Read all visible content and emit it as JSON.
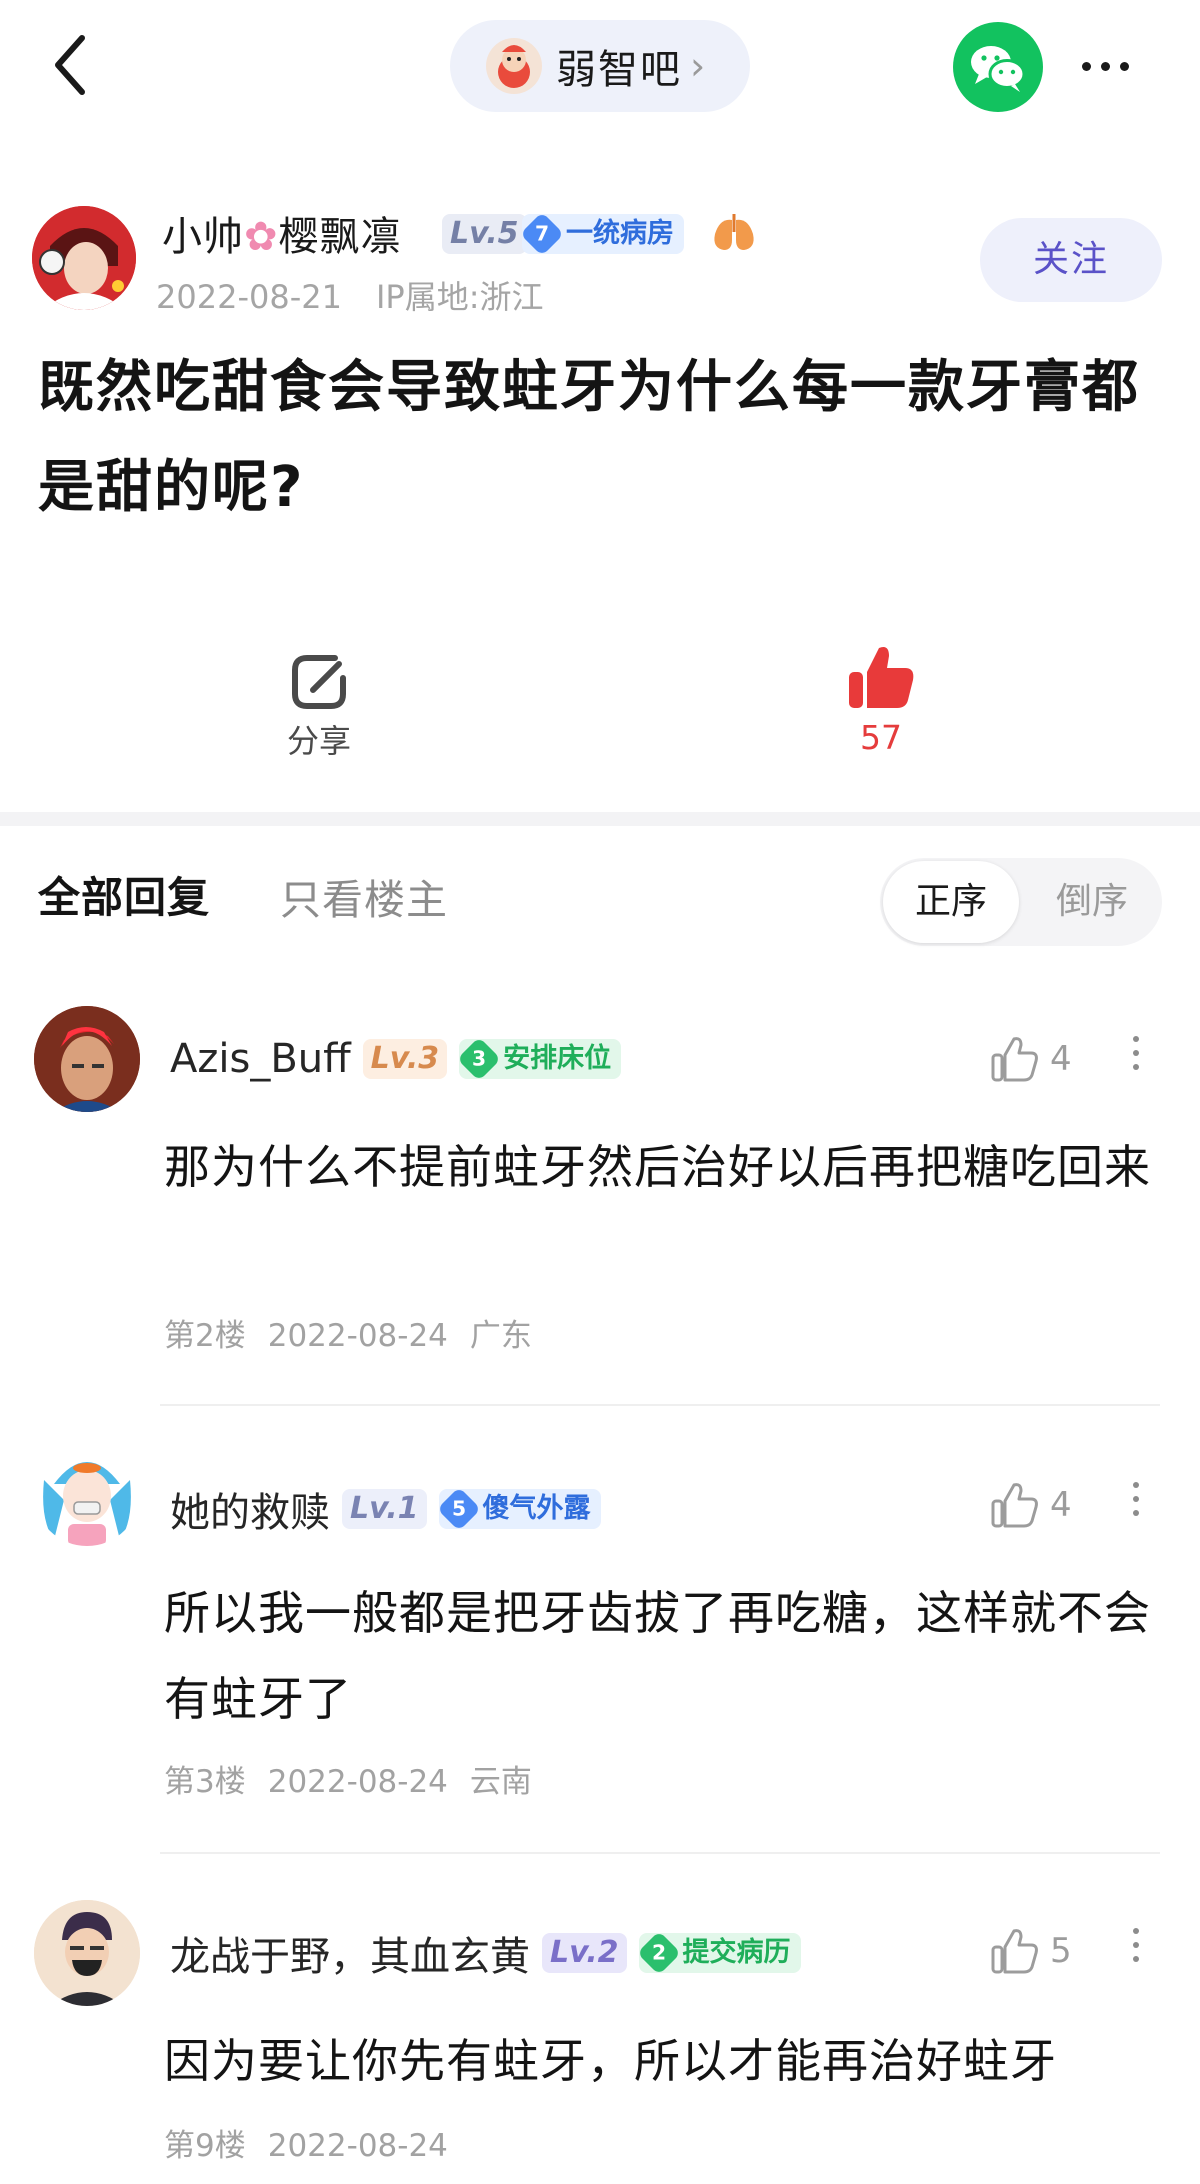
{
  "nav": {
    "forum_name": "弱智吧",
    "chevron": "›"
  },
  "author": {
    "name_part1": "小帅",
    "name_part2": "樱飘凛",
    "level": "Lv.5",
    "badge_num": "7",
    "badge_text": "一统病房",
    "date": "2022-08-21",
    "ip": "IP属地:浙江",
    "follow_label": "关注"
  },
  "post": {
    "title": "既然吃甜食会导致蛀牙为什么每一款牙膏都是甜的呢?"
  },
  "actions": {
    "share_label": "分享",
    "like_count": "57"
  },
  "tabs": {
    "all": "全部回复",
    "op_only": "只看楼主",
    "sort_asc": "正序",
    "sort_desc": "倒序"
  },
  "replies": [
    {
      "name": "Azis_Buff",
      "level": "Lv.3",
      "badge_num": "3",
      "badge_text": "安排床位",
      "badge_color": "green",
      "likes": "4",
      "content": "那为什么不提前蛀牙然后治好以后再把糖吃回来",
      "floor": "第2楼",
      "date": "2022-08-24",
      "location": "广东"
    },
    {
      "name": "她的救赎",
      "level": "Lv.1",
      "badge_num": "5",
      "badge_text": "傻气外露",
      "badge_color": "blue",
      "likes": "4",
      "content": "所以我一般都是把牙齿拔了再吃糖，这样就不会有蛀牙了",
      "floor": "第3楼",
      "date": "2022-08-24",
      "location": "云南"
    },
    {
      "name": "龙战于野，其血玄黄",
      "level": "Lv.2",
      "badge_num": "2",
      "badge_text": "提交病历",
      "badge_color": "green",
      "likes": "5",
      "content": "因为要让你先有蛀牙，所以才能再治好蛀牙",
      "floor": "第9楼",
      "date": "2022-08-24",
      "location": ""
    }
  ],
  "colors": {
    "like_red": "#e53c3c",
    "wechat_green": "#12c25f",
    "follow_purple": "#5a52c8"
  }
}
